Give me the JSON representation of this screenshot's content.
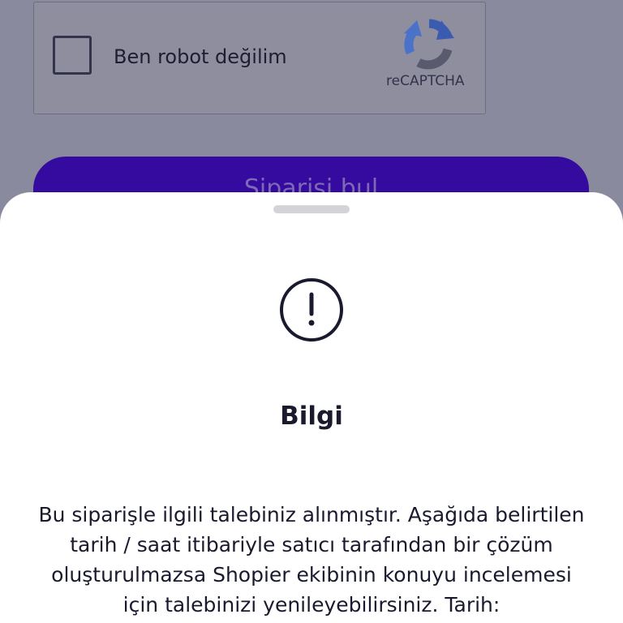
{
  "recaptcha": {
    "label": "Ben robot değilim",
    "brand": "reCAPTCHA",
    "logo_icon": "recaptcha-logo-icon"
  },
  "find_order": {
    "label": "Siparişi bul"
  },
  "sheet": {
    "icon": "exclamation-circle-icon",
    "title": "Bilgi",
    "message": "Bu siparişle ilgili talebiniz alınmıştır. Aşağıda belirtilen tarih / saat itibariyle satıcı tarafından bir çözüm oluşturulmazsa Shopier ekibinin konuyu incelemesi için talebinizi yenileyebilirsiniz. Tarih:"
  },
  "colors": {
    "overlay": "#8a8a9e",
    "primary_button": "#350a9e",
    "sheet_background": "#ffffff",
    "text_dark": "#1a1a2e"
  }
}
